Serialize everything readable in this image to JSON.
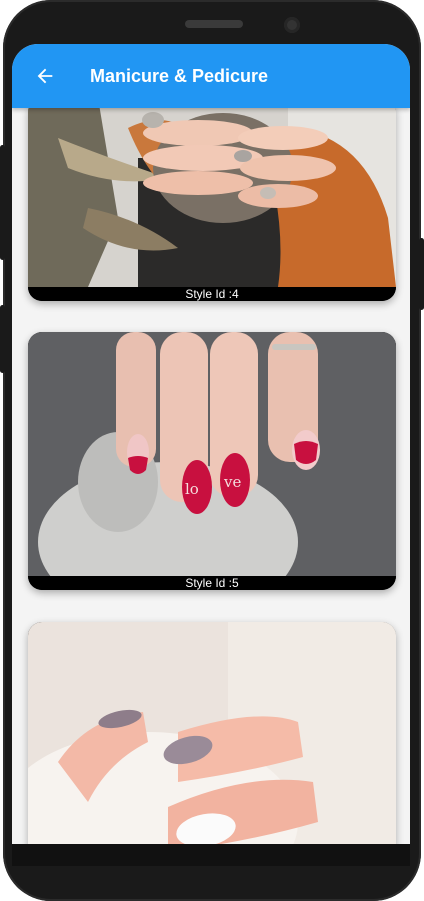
{
  "appbar": {
    "title": "Manicure & Pedicure",
    "back_icon": "arrow-left-icon",
    "color": "#2196f3"
  },
  "cards": [
    {
      "caption": "Style Id :4"
    },
    {
      "caption": "Style Id :5"
    },
    {
      "caption": ""
    }
  ]
}
